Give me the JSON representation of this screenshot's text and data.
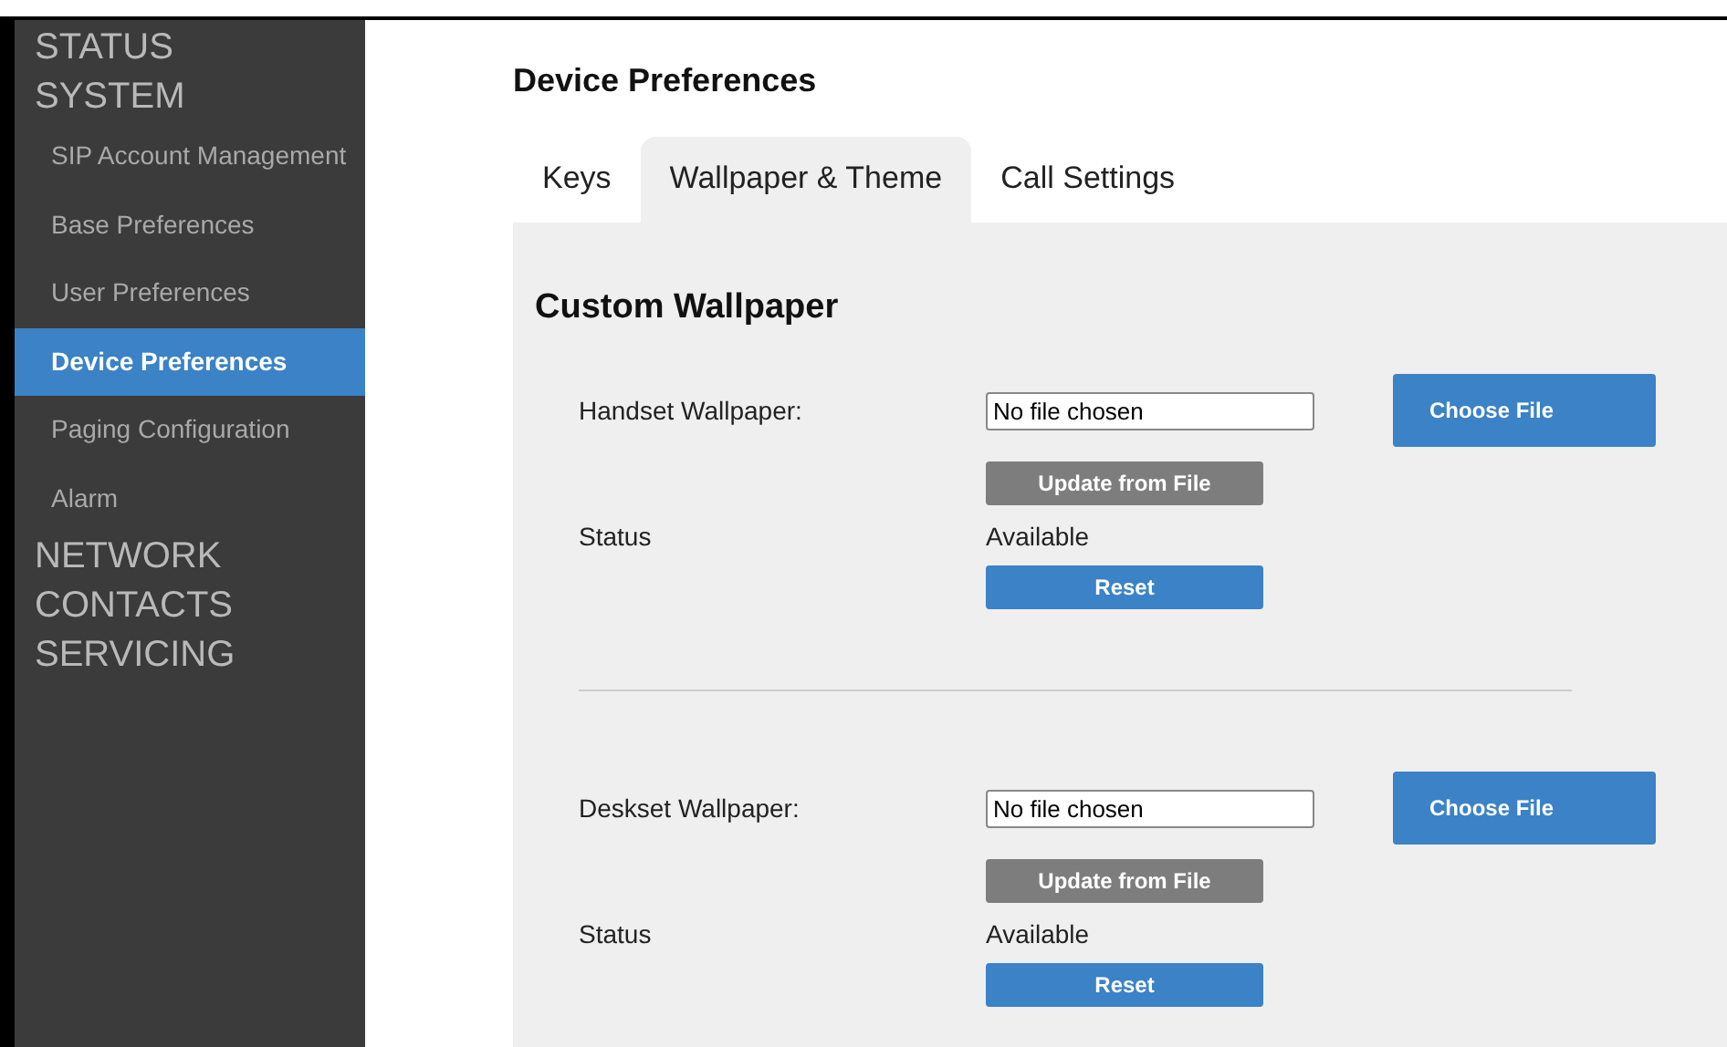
{
  "sidebar": {
    "items": [
      {
        "label": "STATUS"
      },
      {
        "label": "SYSTEM",
        "children": [
          {
            "label": "SIP Account Management",
            "selected": false
          },
          {
            "label": "Base Preferences",
            "selected": false
          },
          {
            "label": "User Preferences",
            "selected": false
          },
          {
            "label": "Device Preferences",
            "selected": true
          },
          {
            "label": "Paging Configuration",
            "selected": false
          },
          {
            "label": "Alarm",
            "selected": false
          }
        ]
      },
      {
        "label": "NETWORK"
      },
      {
        "label": "CONTACTS"
      },
      {
        "label": "SERVICING"
      }
    ]
  },
  "page_title": "Device Preferences",
  "tabs": [
    {
      "label": "Keys",
      "selected": false
    },
    {
      "label": "Wallpaper & Theme",
      "selected": true
    },
    {
      "label": "Call Settings",
      "selected": false
    }
  ],
  "section_title": "Custom Wallpaper",
  "wallpapers": [
    {
      "label": "Handset Wallpaper:",
      "file_value": "No file chosen",
      "choose_button": "Choose File",
      "update_button": {
        "label": "Update from File",
        "disabled": true
      },
      "status_label": "Status",
      "status_value": "Available",
      "reset_button": "Reset"
    },
    {
      "label": "Deskset Wallpaper:",
      "file_value": "No file chosen",
      "choose_button": "Choose File",
      "update_button": {
        "label": "Update from File",
        "disabled": true
      },
      "status_label": "Status",
      "status_value": "Available",
      "reset_button": "Reset"
    }
  ]
}
